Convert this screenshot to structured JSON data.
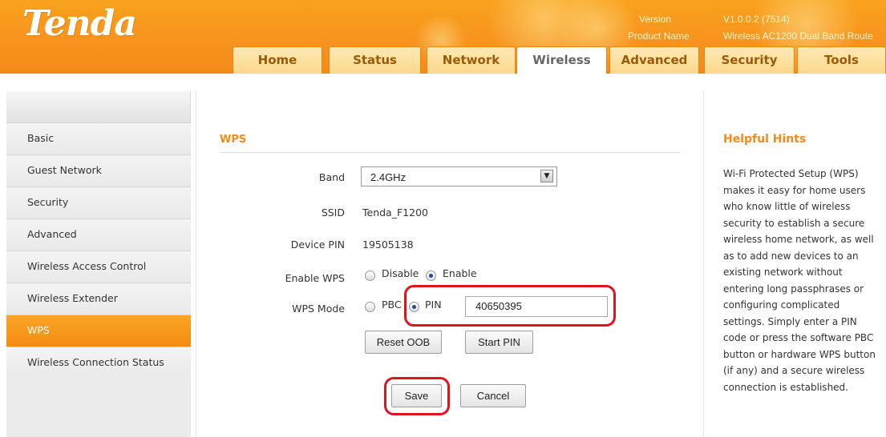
{
  "header": {
    "logo": "Tenda",
    "version_label": "Version",
    "version_value": "V1.0.0.2 (7514)",
    "product_label": "Product Name",
    "product_value": "Wireless AC1200 Dual Band Route"
  },
  "tabs": [
    {
      "label": "Home"
    },
    {
      "label": "Status"
    },
    {
      "label": "Network"
    },
    {
      "label": "Wireless",
      "active": true
    },
    {
      "label": "Advanced"
    },
    {
      "label": "Security"
    },
    {
      "label": "Tools"
    }
  ],
  "sidebar": {
    "items": [
      {
        "label": "Basic"
      },
      {
        "label": "Guest Network"
      },
      {
        "label": "Security"
      },
      {
        "label": "Advanced"
      },
      {
        "label": "Wireless Access Control"
      },
      {
        "label": "Wireless Extender"
      },
      {
        "label": "WPS",
        "active": true
      },
      {
        "label": "Wireless Connection Status"
      }
    ]
  },
  "main": {
    "section_title": "WPS",
    "band": {
      "label": "Band",
      "value": "2.4GHz"
    },
    "ssid": {
      "label": "SSID",
      "value": "Tenda_F1200"
    },
    "device_pin": {
      "label": "Device PIN",
      "value": "19505138"
    },
    "enable_wps": {
      "label": "Enable WPS",
      "disable": "Disable",
      "enable": "Enable",
      "selected": "Enable"
    },
    "wps_mode": {
      "label": "WPS Mode",
      "pbc": "PBC",
      "pin": "PIN",
      "selected": "PIN",
      "pin_value": "40650395"
    },
    "buttons": {
      "reset_oob": "Reset OOB",
      "start_pin": "Start PIN",
      "save": "Save",
      "cancel": "Cancel"
    }
  },
  "hints": {
    "title": "Helpful Hints",
    "text": "Wi-Fi Protected Setup (WPS) makes it easy for home users who know little of wireless security to establish a secure wireless home network, as well as to add new devices to an existing network without entering long passphrases or configuring complicated settings. Simply enter a PIN code or press the software PBC button or hardware WPS button (if any) and a secure wireless connection is established."
  },
  "colors": {
    "brand_orange": "#f7931e",
    "title_orange": "#f58a1a",
    "annotation_red": "#e0141e"
  }
}
